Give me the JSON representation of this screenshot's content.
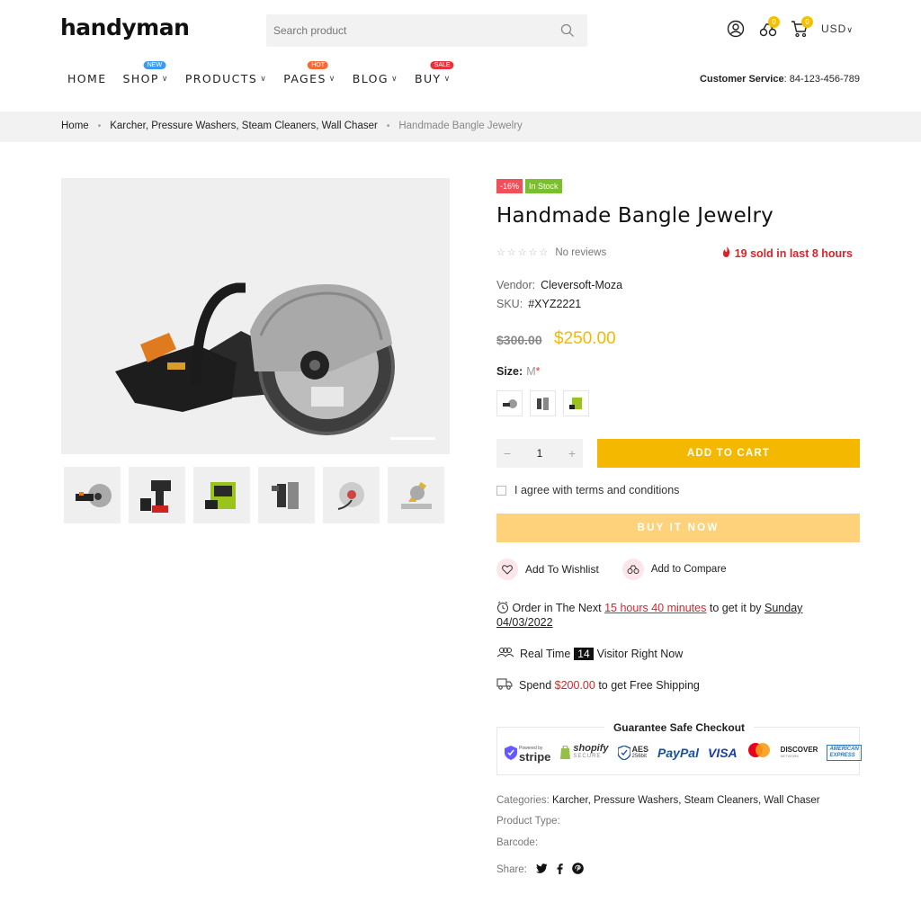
{
  "header": {
    "logo": "handyman",
    "search_placeholder": "Search product",
    "wishlist_count": "0",
    "cart_count": "0",
    "currency": "USD",
    "customer_service_label": "Customer Service",
    "customer_service_phone": ": 84-123-456-789"
  },
  "nav": [
    {
      "label": "HOME",
      "tag": ""
    },
    {
      "label": "SHOP",
      "tag": "NEW",
      "tag_color": "#3d9be9"
    },
    {
      "label": "PRODUCTS",
      "tag": ""
    },
    {
      "label": "PAGES",
      "tag": "HOT",
      "tag_color": "#f26b3a"
    },
    {
      "label": "BLOG",
      "tag": ""
    },
    {
      "label": "BUY",
      "tag": "SALE",
      "tag_color": "#e5323b"
    }
  ],
  "breadcrumb": {
    "home": "Home",
    "category": "Karcher, Pressure Washers, Steam Cleaners, Wall Chaser",
    "current": "Handmade Bangle Jewelry"
  },
  "product": {
    "discount_tag": "-16%",
    "stock_tag": "In Stock",
    "title": "Handmade Bangle Jewelry",
    "reviews": "No reviews",
    "sold": "19 sold in last 8 hours",
    "vendor_label": "Vendor:",
    "vendor": "Cleversoft-Moza",
    "sku_label": "SKU:",
    "sku": "#XYZ2221",
    "price_old": "$300.00",
    "price_new": "$250.00",
    "size_label": "Size:",
    "size_value": "M",
    "size_required": "*",
    "quantity": "1",
    "add_to_cart": "ADD TO CART",
    "agree": "I agree with terms and conditions",
    "buy_now": "BUY IT NOW",
    "wishlist": "Add To Wishlist",
    "compare": "Add to Compare",
    "order_prefix": "Order in The Next",
    "order_time": "15 hours 40 minutes",
    "order_mid": "to get it by",
    "order_day": "Sunday",
    "order_date": "04/03/2022",
    "visitor_prefix": "Real Time",
    "visitor_count": "14",
    "visitor_suffix": "Visitor Right Now",
    "ship_prefix": "Spend",
    "ship_amount": "$200.00",
    "ship_suffix": "to get Free Shipping",
    "guarantee_title": "Guarantee Safe Checkout",
    "categories_label": "Categories:",
    "categories": "Karcher, Pressure Washers, Steam Cleaners, Wall Chaser",
    "type_label": "Product Type:",
    "barcode_label": "Barcode:",
    "share_label": "Share:"
  },
  "payments": [
    "Powered by",
    "stripe",
    "shopify",
    "SECURE",
    "AES",
    "256bit",
    "PayPal",
    "VISA",
    "DISCOVER",
    "NETWORK",
    "AMERICAN",
    "EXPRESS"
  ],
  "colors": {
    "accent": "#f5b800",
    "buy_now": "#fdd27a",
    "sale_red": "#d9232d",
    "stock_green": "#7bbf2e",
    "discount_red": "#f0505a"
  }
}
